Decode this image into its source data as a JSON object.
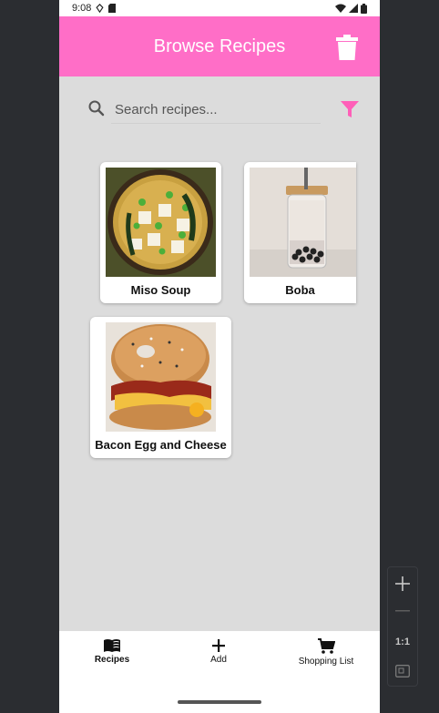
{
  "status_bar": {
    "time": "9:08"
  },
  "app_bar": {
    "title": "Browse Recipes",
    "delete_icon": "trash-icon"
  },
  "search": {
    "placeholder": "Search recipes...",
    "value": "",
    "filter_icon": "filter-icon"
  },
  "recipes": [
    {
      "name": "Miso Soup"
    },
    {
      "name": "Boba"
    },
    {
      "name": "Bacon Egg and Cheese"
    }
  ],
  "bottom_nav": {
    "items": [
      {
        "label": "Recipes",
        "icon": "book-icon",
        "active": true
      },
      {
        "label": "Add",
        "icon": "plus-icon",
        "active": false
      },
      {
        "label": "Shopping List",
        "icon": "cart-icon",
        "active": false
      }
    ]
  },
  "zoom_controls": {
    "ratio_label": "1:1"
  },
  "colors": {
    "accent": "#ff6ec7",
    "background": "#dcdcdc",
    "filter": "#ff5fb8"
  }
}
